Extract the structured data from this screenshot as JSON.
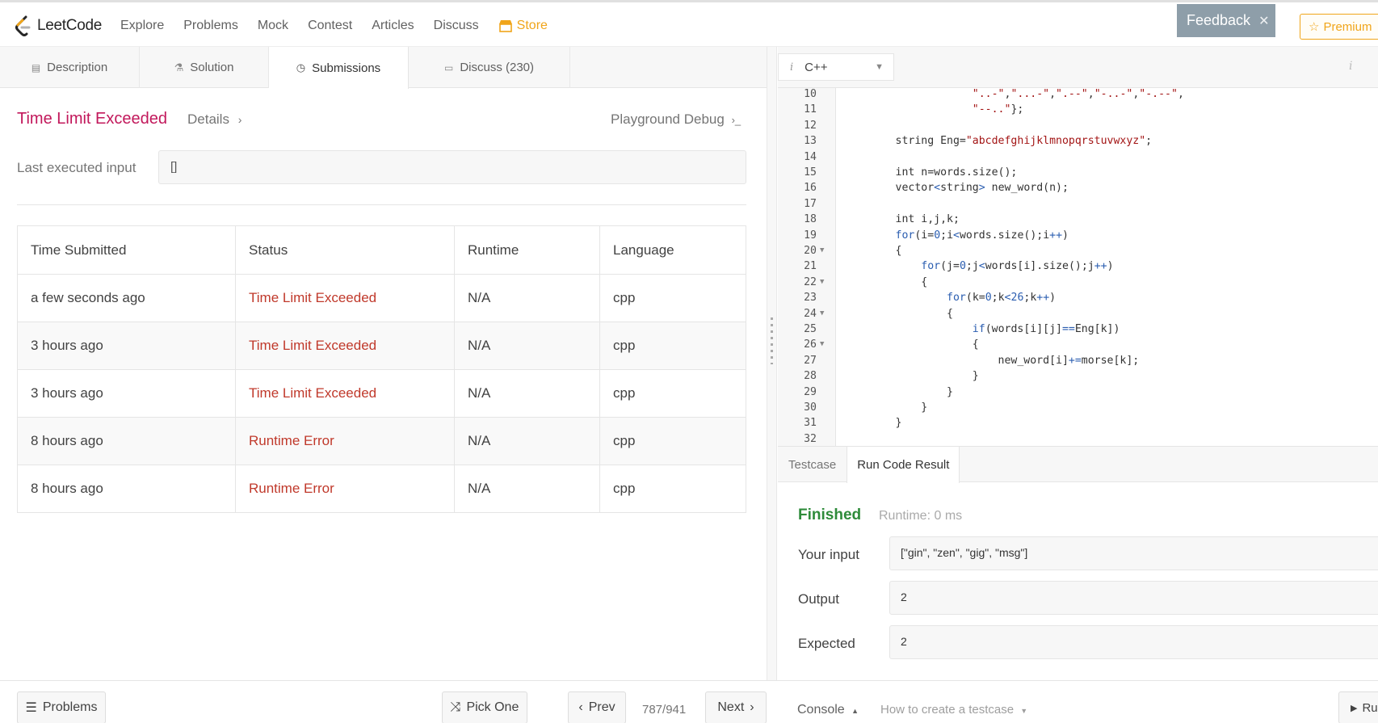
{
  "nav": {
    "logo_text": "LeetCode",
    "items": [
      "Explore",
      "Problems",
      "Mock",
      "Contest",
      "Articles",
      "Discuss"
    ],
    "store": "Store",
    "feedback": "Feedback",
    "premium": "Premium"
  },
  "left_tabs": [
    "Description",
    "Solution",
    "Submissions",
    "Discuss (230)"
  ],
  "result": {
    "title": "Time Limit Exceeded",
    "details": "Details",
    "playground": "Playground Debug",
    "last_input_label": "Last executed input",
    "last_input_value": "[]"
  },
  "submissions": {
    "headers": [
      "Time Submitted",
      "Status",
      "Runtime",
      "Language"
    ],
    "rows": [
      {
        "time": "a few seconds ago",
        "status": "Time Limit Exceeded",
        "runtime": "N/A",
        "language": "cpp"
      },
      {
        "time": "3 hours ago",
        "status": "Time Limit Exceeded",
        "runtime": "N/A",
        "language": "cpp"
      },
      {
        "time": "3 hours ago",
        "status": "Time Limit Exceeded",
        "runtime": "N/A",
        "language": "cpp"
      },
      {
        "time": "8 hours ago",
        "status": "Runtime Error",
        "runtime": "N/A",
        "language": "cpp"
      },
      {
        "time": "8 hours ago",
        "status": "Runtime Error",
        "runtime": "N/A",
        "language": "cpp"
      }
    ]
  },
  "editor": {
    "language": "C++",
    "lines": [
      {
        "n": 10,
        "fold": false,
        "code": "                    \"..-\",\"...-\",\".--\",\"-..-\",\"-.--\","
      },
      {
        "n": 11,
        "fold": false,
        "code": "                    \"--..\"};"
      },
      {
        "n": 12,
        "fold": false,
        "code": ""
      },
      {
        "n": 13,
        "fold": false,
        "code": "        string Eng=\"abcdefghijklmnopqrstuvwxyz\";"
      },
      {
        "n": 14,
        "fold": false,
        "code": ""
      },
      {
        "n": 15,
        "fold": false,
        "code": "        int n=words.size();"
      },
      {
        "n": 16,
        "fold": false,
        "code": "        vector<string> new_word(n);"
      },
      {
        "n": 17,
        "fold": false,
        "code": ""
      },
      {
        "n": 18,
        "fold": false,
        "code": "        int i,j,k;"
      },
      {
        "n": 19,
        "fold": false,
        "code": "        for(i=0;i<words.size();i++)"
      },
      {
        "n": 20,
        "fold": true,
        "code": "        {"
      },
      {
        "n": 21,
        "fold": false,
        "code": "            for(j=0;j<words[i].size();j++)"
      },
      {
        "n": 22,
        "fold": true,
        "code": "            {"
      },
      {
        "n": 23,
        "fold": false,
        "code": "                for(k=0;k<26;k++)"
      },
      {
        "n": 24,
        "fold": true,
        "code": "                {"
      },
      {
        "n": 25,
        "fold": false,
        "code": "                    if(words[i][j]==Eng[k])"
      },
      {
        "n": 26,
        "fold": true,
        "code": "                    {"
      },
      {
        "n": 27,
        "fold": false,
        "code": "                        new_word[i]+=morse[k];"
      },
      {
        "n": 28,
        "fold": false,
        "code": "                    }"
      },
      {
        "n": 29,
        "fold": false,
        "code": "                }"
      },
      {
        "n": 30,
        "fold": false,
        "code": "            }"
      },
      {
        "n": 31,
        "fold": false,
        "code": "        }"
      },
      {
        "n": 32,
        "fold": false,
        "code": ""
      }
    ]
  },
  "console": {
    "tabs": [
      "Testcase",
      "Run Code Result"
    ],
    "status": "Finished",
    "runtime": "Runtime: 0 ms",
    "input_label": "Your input",
    "input_value": "[\"gin\", \"zen\", \"gig\", \"msg\"]",
    "output_label": "Output",
    "output_value": "2",
    "expected_label": "Expected",
    "expected_value": "2"
  },
  "bottom": {
    "problems": "Problems",
    "pick_one": "Pick One",
    "prev": "Prev",
    "pager": "787/941",
    "next": "Next",
    "console": "Console",
    "howto": "How to create a testcase",
    "run": "Ru"
  },
  "colors": {
    "error": "#c0392b",
    "title": "#c2185b",
    "success": "#2e8b3a",
    "store": "#f0a51a",
    "feedback_bg": "#8e9ea9"
  }
}
